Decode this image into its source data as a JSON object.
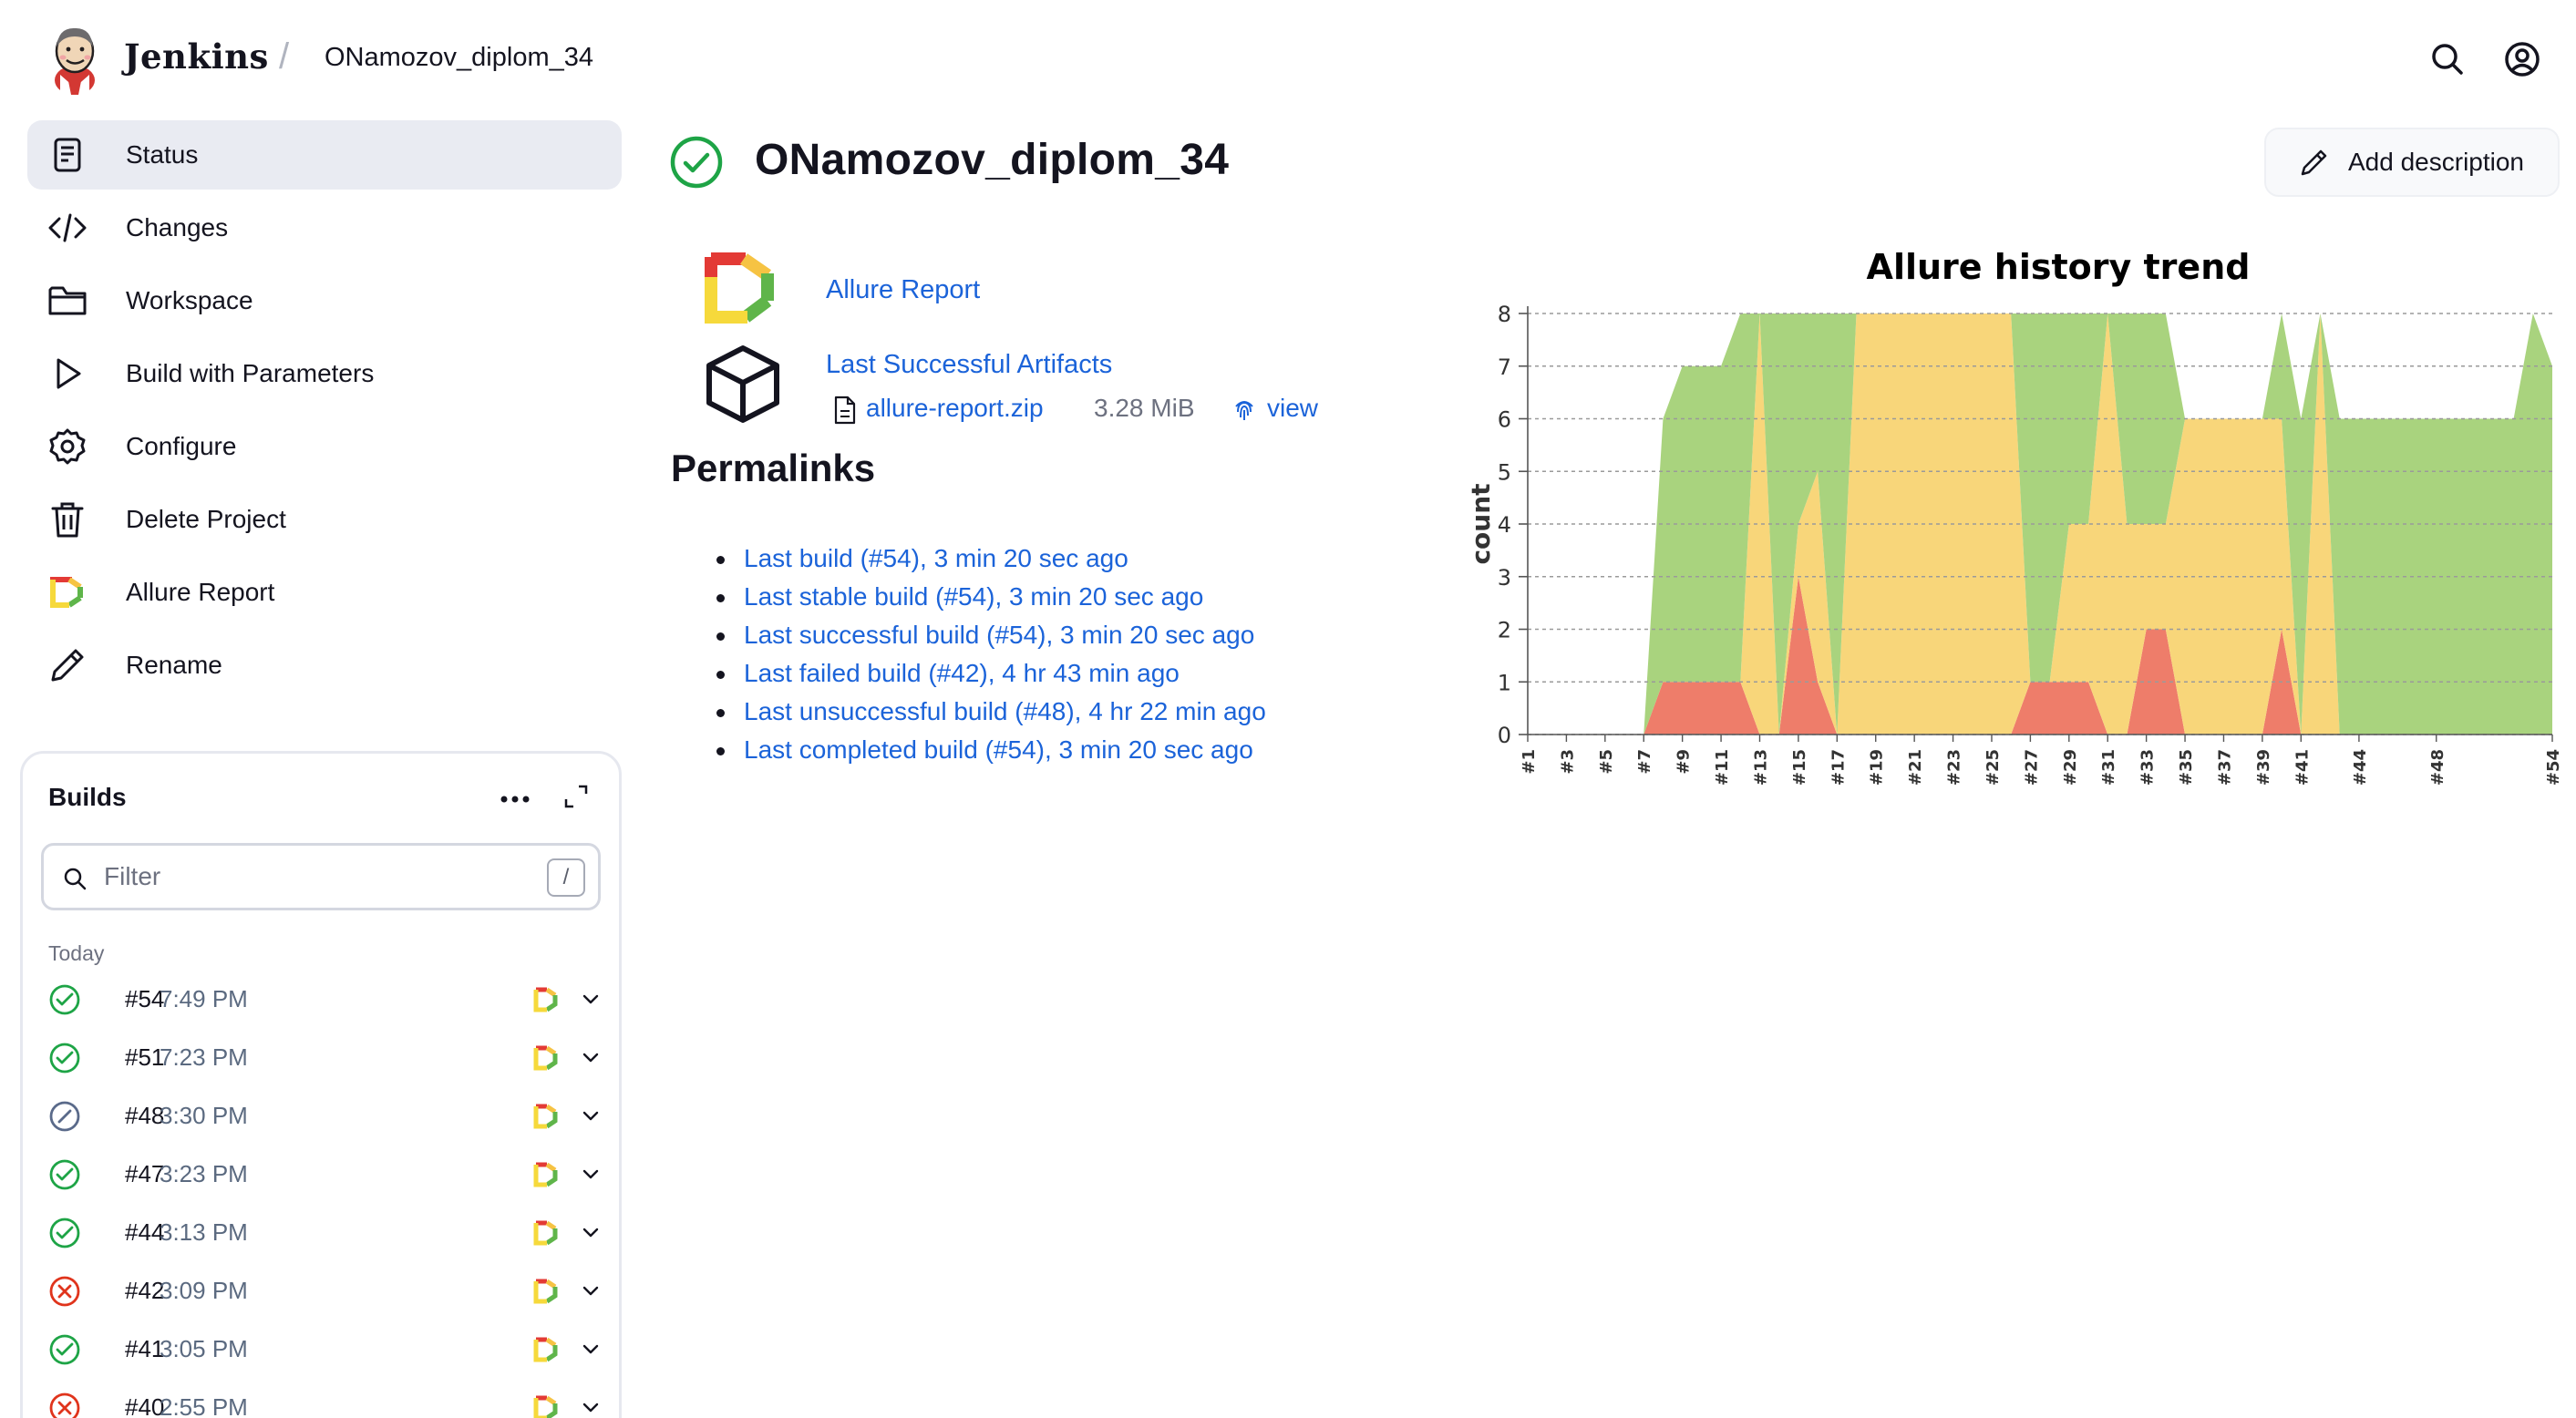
{
  "header": {
    "brand": "Jenkins",
    "separator": "/",
    "breadcrumb": "ONamozov_diplom_34",
    "icons": [
      "search-icon",
      "account-icon"
    ]
  },
  "nav": {
    "items": [
      {
        "label": "Status",
        "icon": "status-icon",
        "active": true
      },
      {
        "label": "Changes",
        "icon": "code-icon"
      },
      {
        "label": "Workspace",
        "icon": "folder-icon"
      },
      {
        "label": "Build with Parameters",
        "icon": "play-icon"
      },
      {
        "label": "Configure",
        "icon": "gear-icon"
      },
      {
        "label": "Delete Project",
        "icon": "trash-icon"
      },
      {
        "label": "Allure Report",
        "icon": "allure-icon"
      },
      {
        "label": "Rename",
        "icon": "pencil-icon"
      }
    ]
  },
  "builds": {
    "title": "Builds",
    "filter_placeholder": "Filter",
    "filter_shortcut": "/",
    "group_label": "Today",
    "items": [
      {
        "number": "#54",
        "time": "7:49 PM",
        "status": "success"
      },
      {
        "number": "#51",
        "time": "7:23 PM",
        "status": "success"
      },
      {
        "number": "#48",
        "time": "3:30 PM",
        "status": "aborted"
      },
      {
        "number": "#47",
        "time": "3:23 PM",
        "status": "success"
      },
      {
        "number": "#44",
        "time": "3:13 PM",
        "status": "success"
      },
      {
        "number": "#42",
        "time": "3:09 PM",
        "status": "failed"
      },
      {
        "number": "#41",
        "time": "3:05 PM",
        "status": "success"
      },
      {
        "number": "#40",
        "time": "2:55 PM",
        "status": "failed"
      }
    ]
  },
  "main": {
    "title": "ONamozov_diplom_34",
    "add_description": "Add description",
    "allure_report_link": "Allure Report",
    "artifacts": {
      "title": "Last Successful Artifacts",
      "file_name": "allure-report.zip",
      "file_size": "3.28 MiB",
      "view_label": "view"
    },
    "permalinks_title": "Permalinks",
    "permalinks": [
      "Last build (#54), 3 min 20 sec ago",
      "Last stable build (#54), 3 min 20 sec ago",
      "Last successful build (#54), 3 min 20 sec ago",
      "Last failed build (#42), 4 hr 43 min ago",
      "Last unsuccessful build (#48), 4 hr 22 min ago",
      "Last completed build (#54), 3 min 20 sec ago"
    ]
  },
  "colors": {
    "accent_link": "#1b63d9",
    "success": "#1ea446",
    "failed": "#e0341c",
    "aborted": "#5a6a8a",
    "passed_area": "#a9d37e",
    "broken_area": "#f8d67a",
    "failed_area": "#ee7d6a"
  },
  "chart_data": {
    "type": "area",
    "stacked": true,
    "title": "Allure history trend",
    "xlabel": "",
    "ylabel": "count",
    "ylim": [
      0,
      8
    ],
    "yticks": [
      0,
      1,
      2,
      3,
      4,
      5,
      6,
      7,
      8
    ],
    "grid": true,
    "x_tick_labels": [
      "#1",
      "#3",
      "#5",
      "#7",
      "#9",
      "#11",
      "#13",
      "#15",
      "#17",
      "#19",
      "#21",
      "#23",
      "#25",
      "#27",
      "#29",
      "#31",
      "#33",
      "#35",
      "#37",
      "#39",
      "#41",
      "#44",
      "#48",
      "#54"
    ],
    "x": [
      "#1",
      "#2",
      "#3",
      "#4",
      "#5",
      "#6",
      "#7",
      "#8",
      "#9",
      "#10",
      "#11",
      "#12",
      "#13",
      "#14",
      "#15",
      "#16",
      "#17",
      "#18",
      "#19",
      "#20",
      "#21",
      "#22",
      "#23",
      "#24",
      "#25",
      "#26",
      "#27",
      "#28",
      "#29",
      "#30",
      "#31",
      "#32",
      "#33",
      "#34",
      "#35",
      "#36",
      "#37",
      "#38",
      "#39",
      "#40",
      "#41",
      "#42",
      "#43",
      "#44",
      "#45",
      "#46",
      "#47",
      "#48",
      "#49",
      "#50",
      "#51",
      "#52",
      "#53",
      "#54"
    ],
    "series": [
      {
        "color": "#ee7d6a",
        "values": [
          0,
          0,
          0,
          0,
          0,
          0,
          0,
          1,
          1,
          1,
          1,
          1,
          0,
          0,
          3,
          1,
          0,
          0,
          0,
          0,
          0,
          0,
          0,
          0,
          0,
          0,
          1,
          1,
          1,
          1,
          0,
          0,
          2,
          2,
          0,
          0,
          0,
          0,
          0,
          2,
          0,
          0,
          0,
          0,
          0,
          0,
          0,
          0,
          0,
          0,
          0,
          0,
          0,
          0
        ]
      },
      {
        "color": "#f8d67a",
        "values": [
          0,
          0,
          0,
          0,
          0,
          0,
          0,
          0,
          0,
          0,
          0,
          0,
          8,
          0,
          1,
          4,
          0,
          8,
          8,
          8,
          8,
          8,
          8,
          8,
          8,
          8,
          0,
          0,
          3,
          3,
          8,
          4,
          2,
          2,
          6,
          6,
          6,
          6,
          6,
          4,
          0,
          8,
          0,
          0,
          0,
          0,
          0,
          0,
          0,
          0,
          0,
          0,
          0,
          0
        ]
      },
      {
        "color": "#a9d37e",
        "values": [
          0,
          0,
          0,
          0,
          0,
          0,
          0,
          5,
          6,
          6,
          6,
          7,
          0,
          8,
          4,
          3,
          8,
          0,
          0,
          0,
          0,
          0,
          0,
          0,
          0,
          0,
          7,
          7,
          4,
          4,
          0,
          4,
          4,
          4,
          0,
          0,
          0,
          0,
          0,
          2,
          6,
          0,
          6,
          6,
          6,
          6,
          6,
          6,
          6,
          6,
          6,
          6,
          8,
          7
        ]
      }
    ]
  }
}
